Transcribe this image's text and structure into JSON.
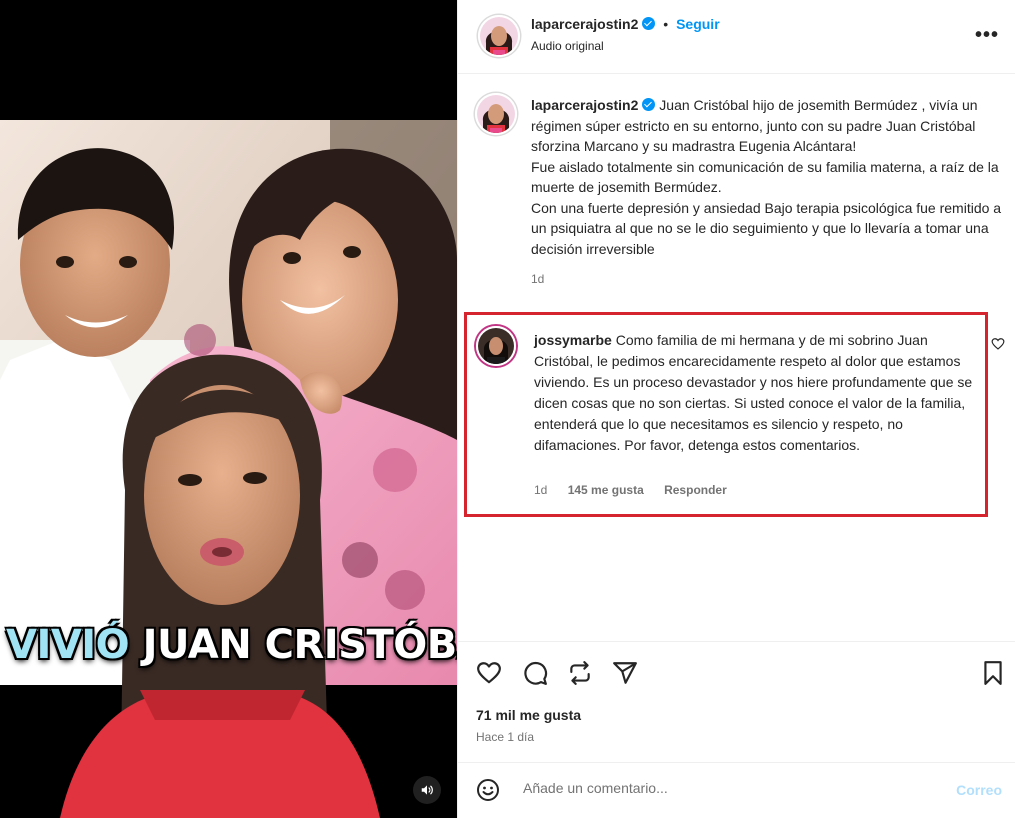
{
  "media": {
    "overlay_accent": "VIVIÓ",
    "overlay_main": "JUAN CRISTÓBAL",
    "mute_icon": "speaker-icon"
  },
  "header": {
    "username": "laparcerajostin2",
    "follow_label": "Seguir",
    "separator": "•",
    "audio_label": "Audio original",
    "more_label": "•••"
  },
  "caption": {
    "username": "laparcerajostin2",
    "paragraphs": [
      "Juan Cristóbal hijo de josemith Bermúdez , vivía un régimen súper estricto en su entorno, junto con su padre Juan Cristóbal sforzina Marcano y su madrastra Eugenia Alcántara!",
      "Fue aislado totalmente sin comunicación de su familia materna, a raíz de la muerte de josemith Bermúdez.",
      "Con una fuerte depresión y ansiedad Bajo terapia psicológica fue remitido a un psiquiatra al que no se le dio seguimiento y que lo llevaría a tomar una decisión irreversible"
    ],
    "time": "1d"
  },
  "comment": {
    "username": "jossymarbe",
    "text": "Como familia de mi hermana y de mi sobrino Juan Cristóbal, le pedimos encarecidamente respeto al dolor que estamos viviendo. Es un proceso devastador y nos hiere profundamente que se dicen cosas que no son ciertas. Si usted conoce el valor de la familia, entenderá que lo que necesitamos es silencio y respeto, no difamaciones. Por favor, detenga estos comentarios.",
    "time": "1d",
    "likes": "145 me gusta",
    "reply": "Responder"
  },
  "footer": {
    "likes": "71 mil me gusta",
    "posted": "Hace 1 día",
    "comment_placeholder": "Añade un comentario...",
    "post_label": "Correo"
  },
  "colors": {
    "accent": "#0095f6",
    "highlight_border": "#d6242e",
    "overlay_accent": "#9fe3f5"
  }
}
